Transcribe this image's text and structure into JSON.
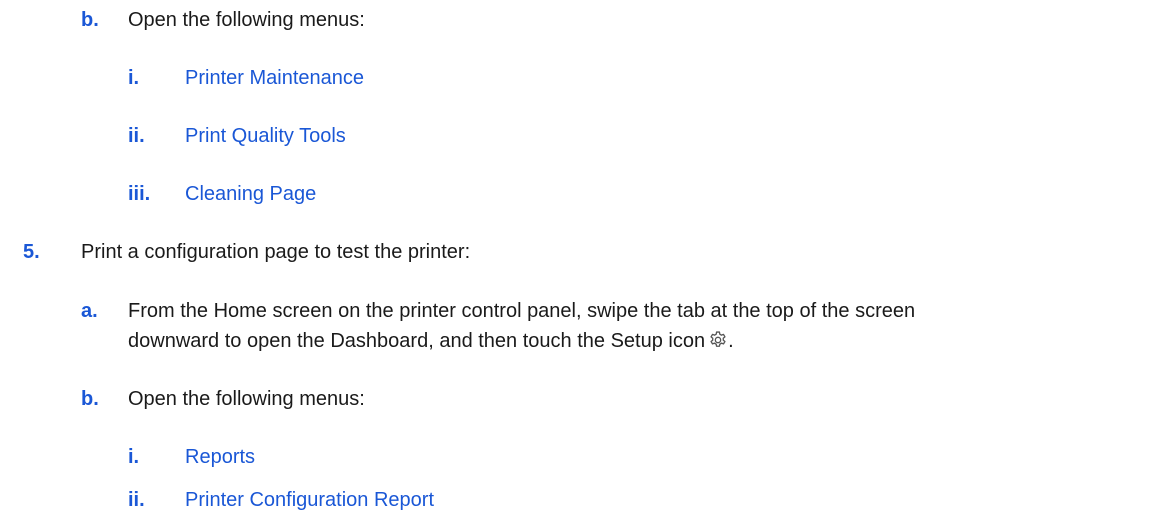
{
  "doc": {
    "step4": {
      "b": {
        "marker": "b.",
        "text": "Open the following menus:",
        "items": [
          {
            "marker": "i.",
            "text": "Printer Maintenance"
          },
          {
            "marker": "ii.",
            "text": "Print Quality Tools"
          },
          {
            "marker": "iii.",
            "text": "Cleaning Page"
          }
        ]
      }
    },
    "step5": {
      "marker": "5.",
      "text": "Print a configuration page to test the printer:",
      "a": {
        "marker": "a.",
        "line1": "From the Home screen on the printer control panel, swipe the tab at the top of the screen",
        "line2": "downward to open the Dashboard, and then touch the Setup icon",
        "line2_end": ".",
        "icon": "gear-icon"
      },
      "b": {
        "marker": "b.",
        "text": "Open the following menus:",
        "items": [
          {
            "marker": "i.",
            "text": "Reports"
          },
          {
            "marker": "ii.",
            "text": "Printer Configuration Report"
          }
        ]
      }
    }
  },
  "colors": {
    "accent": "#1a57d6",
    "text": "#1a1a1a"
  }
}
